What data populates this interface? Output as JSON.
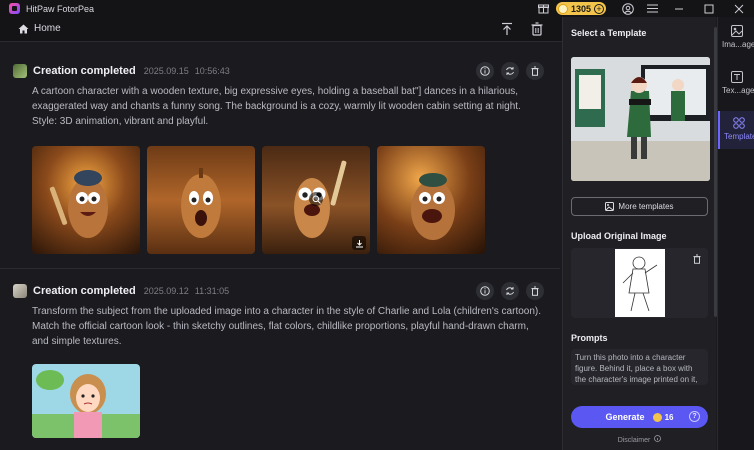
{
  "app": {
    "title": "HitPaw FotorPea",
    "credits": "1305",
    "plus": "+"
  },
  "header": {
    "home_label": "Home"
  },
  "creations": [
    {
      "status": "Creation completed",
      "date": "2025.09.15",
      "time": "10:56:43",
      "text": "A cartoon character with a wooden texture, big expressive eyes, holding a baseball bat\"] dances in a hilarious, exaggerated way and chants a funny song. The background is a cozy, warmly lit wooden cabin setting at night. Style: 3D animation, vibrant and playful."
    },
    {
      "status": "Creation completed",
      "date": "2025.09.12",
      "time": "11:31:05",
      "text": "Transform the subject from the uploaded image into a character in the style of Charlie and Lola (children's cartoon). Match the official cartoon look - thin sketchy outlines, flat colors, childlike proportions, playful hand-drawn charm, and simple textures."
    }
  ],
  "panel": {
    "select_template": "Select a Template",
    "more_templates": "More templates",
    "upload_heading": "Upload Original Image",
    "prompts_heading": "Prompts",
    "prompt_text": "Turn this photo into a character figure. Behind it, place a box with the character's image printed on it,",
    "generate_label": "Generate",
    "generate_cost": "16",
    "help": "?",
    "disclaimer": "Disclaimer"
  },
  "rail": [
    {
      "label": "Ima...age",
      "icon": "image-icon"
    },
    {
      "label": "Tex...age",
      "icon": "text-to-image-icon"
    },
    {
      "label": "Template",
      "icon": "template-icon"
    }
  ],
  "colors": {
    "accent": "#5b57f3",
    "coin": "#f3c44b",
    "background": "#1b1b1f"
  }
}
